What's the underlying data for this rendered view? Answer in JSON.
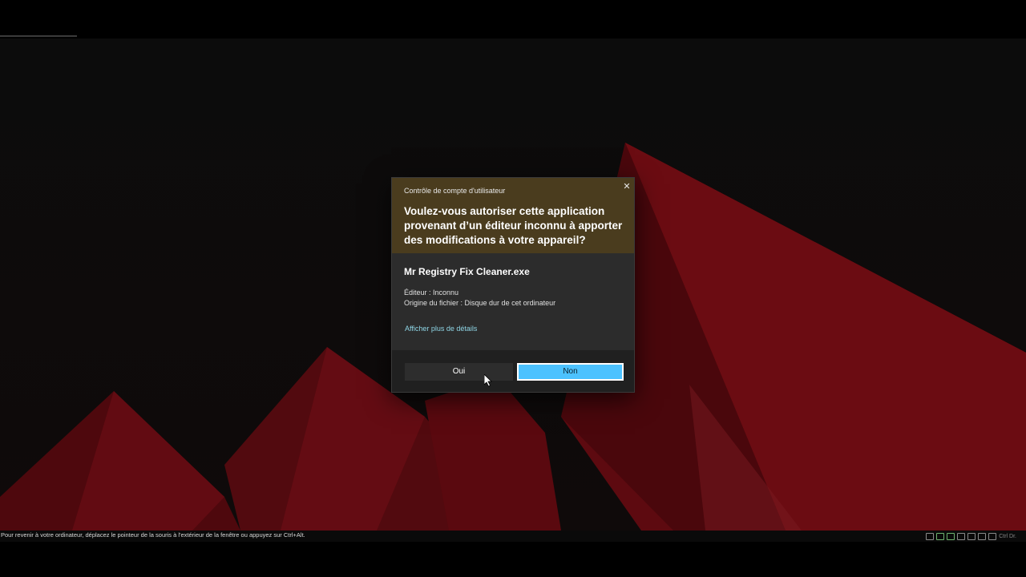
{
  "uac": {
    "caption": "Contrôle de compte d'utilisateur",
    "close_glyph": "✕",
    "question": "Voulez-vous autoriser cette application provenant d’un éditeur inconnu à apporter des modifications à votre appareil?",
    "app_name": "Mr Registry Fix Cleaner.exe",
    "publisher": "Éditeur : Inconnu",
    "origin": "Origine du fichier : Disque dur de cet ordinateur",
    "details_link": "Afficher plus de détails",
    "yes_label": "Oui",
    "no_label": "Non"
  },
  "status_bar": {
    "message": "Pour revenir à votre ordinateur, déplacez le pointeur de la souris à l'extérieur de la fenêtre ou appuyez sur Ctrl+Alt.",
    "icons": [
      "network-icon",
      "cd-icon",
      "usb-icon",
      "usb-icon",
      "shared-folder-icon",
      "display-icon",
      "mouse-icon"
    ],
    "host_key_label": "Ctrl Dr."
  },
  "colors": {
    "header_bg": "#4a3c1e",
    "dialog_bg": "#2c2c2c",
    "accent_button": "#4cc2ff",
    "link": "#8fd6e6",
    "wallpaper_red": "#6b0c12"
  }
}
